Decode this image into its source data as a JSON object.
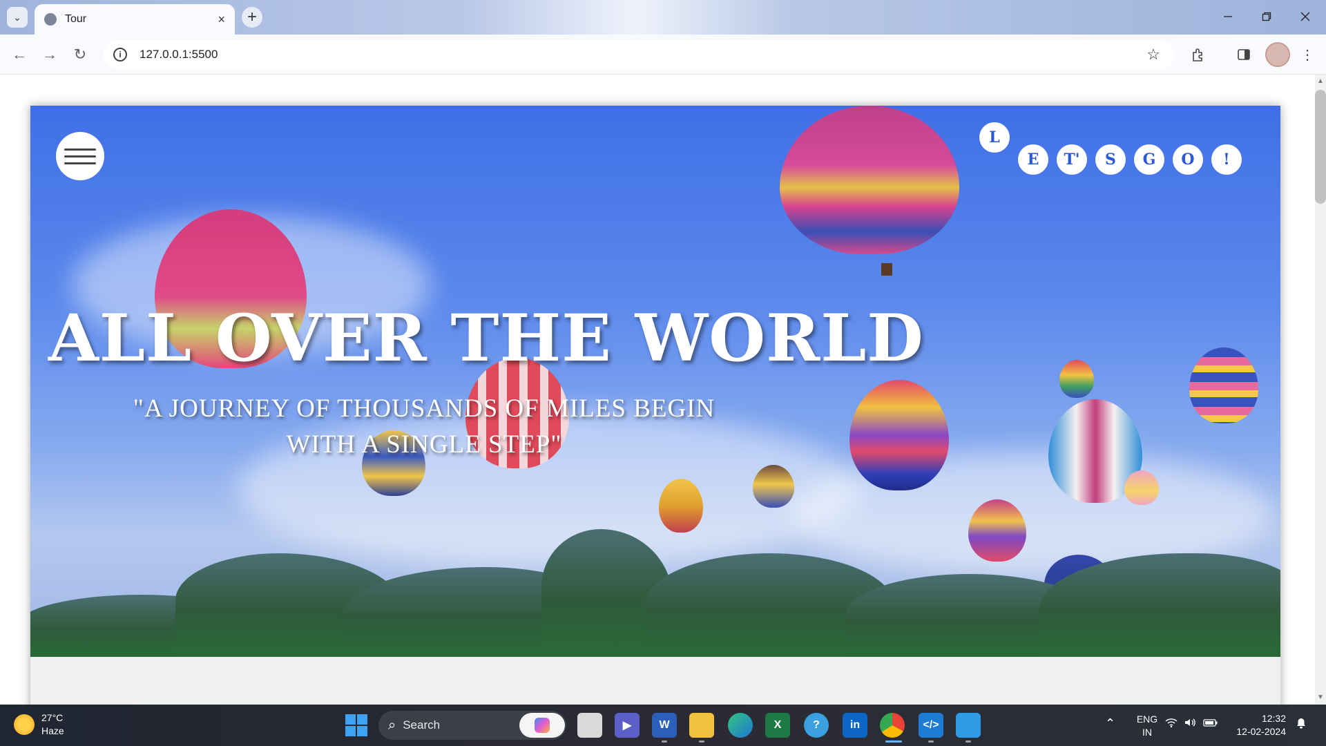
{
  "browser": {
    "tab_title": "Tour",
    "url": "127.0.0.1:5500",
    "new_tab_symbol": "+",
    "close_tab_symbol": "×"
  },
  "page": {
    "bubble_letters": [
      "L",
      "E",
      "T'",
      "S",
      "G",
      "O",
      "!"
    ],
    "hero_title": "ALL OVER THE WORLD",
    "hero_quote_line1": "\"A JOURNEY OF THOUSANDS OF MILES BEGIN",
    "hero_quote_line2": "WITH A SINGLE STEP\""
  },
  "taskbar": {
    "weather_temp": "27°C",
    "weather_desc": "Haze",
    "search_label": "Search",
    "language_line1": "ENG",
    "language_line2": "IN",
    "time": "12:32",
    "date": "12-02-2024",
    "apps": [
      "file-explorer-icon",
      "teams-icon",
      "word-icon",
      "folder-icon",
      "edge-icon",
      "excel-icon",
      "help-icon",
      "linkedin-icon",
      "chrome-icon",
      "vscode-icon",
      "photos-icon"
    ]
  },
  "colors": {
    "letter_color": "#2b58d6",
    "hero_sky_top": "#3f6fe6",
    "taskbar_bg": "#2b2a33"
  }
}
